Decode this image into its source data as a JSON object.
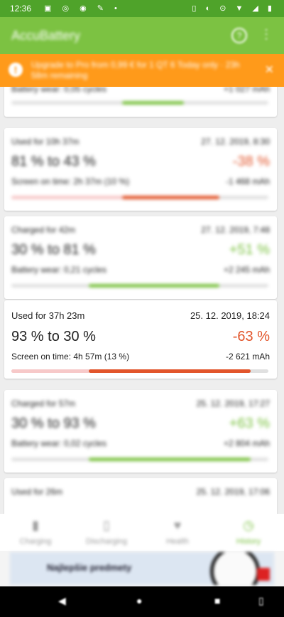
{
  "status_bar": {
    "time": "12:36"
  },
  "app": {
    "title": "AccuBattery"
  },
  "banner": {
    "text": "Upgrade to Pro from 0,99 € for 1 QT 6 Today only · 23h 58m remaining"
  },
  "sessions": [
    {
      "type": "charged",
      "label": "",
      "date": "",
      "range": "",
      "pct": "",
      "sub": "Battery wear: 0,05 cycles",
      "mah": "+1 027 mAh",
      "bar": {
        "pre": 0,
        "start": 0.43,
        "end": 0.67,
        "color": "#7cc242"
      }
    },
    {
      "type": "used",
      "label": "Used for 10h 37m",
      "date": "27. 12. 2019, 8:30",
      "range": "81 % to 43 %",
      "pct": "-38 %",
      "sub": "Screen on time: 2h 37m (10 %)",
      "mah": "-1 468 mAh",
      "bar": {
        "pre": 0.43,
        "start": 0.43,
        "end": 0.81,
        "color": "#e2552b"
      }
    },
    {
      "type": "charged",
      "label": "Charged for 42m",
      "date": "27. 12. 2019, 7:48",
      "range": "30 % to 81 %",
      "pct": "+51 %",
      "sub": "Battery wear: 0,21 cycles",
      "mah": "+2 245 mAh",
      "bar": {
        "pre": 0,
        "start": 0.3,
        "end": 0.81,
        "color": "#7cc242"
      }
    },
    {
      "type": "used",
      "label": "Used for 37h 23m",
      "date": "25. 12. 2019, 18:24",
      "range": "93 % to 30 %",
      "pct": "-63 %",
      "sub": "Screen on time: 4h 57m (13 %)",
      "mah": "-2 621 mAh",
      "bar": {
        "pre": 0.3,
        "start": 0.3,
        "end": 0.93,
        "color": "#e2552b"
      }
    },
    {
      "type": "charged",
      "label": "Charged for 57m",
      "date": "25. 12. 2019, 17:27",
      "range": "30 % to 93 %",
      "pct": "+63 %",
      "sub": "Battery wear: 0,02 cycles",
      "mah": "+2 804 mAh",
      "bar": {
        "pre": 0,
        "start": 0.3,
        "end": 0.93,
        "color": "#7cc242"
      }
    },
    {
      "type": "used",
      "label": "Used for 26m",
      "date": "25. 12. 2019, 17:06",
      "range": "",
      "pct": "",
      "sub": "",
      "mah": "",
      "bar": {
        "pre": 0,
        "start": 0,
        "end": 0,
        "color": "#e2552b"
      }
    }
  ],
  "nav": [
    {
      "label": "Charging",
      "icon": "battery-icon",
      "active": false
    },
    {
      "label": "Discharging",
      "icon": "battery-discharging-icon",
      "active": false
    },
    {
      "label": "Health",
      "icon": "heart-icon",
      "active": false
    },
    {
      "label": "History",
      "icon": "history-icon",
      "active": true
    }
  ],
  "ad": {
    "text": "Najlepšie predmety"
  },
  "colors": {
    "accent": "#7cc242",
    "status": "#4fa32a",
    "banner": "#ff9a1a",
    "negative": "#e2552b"
  }
}
